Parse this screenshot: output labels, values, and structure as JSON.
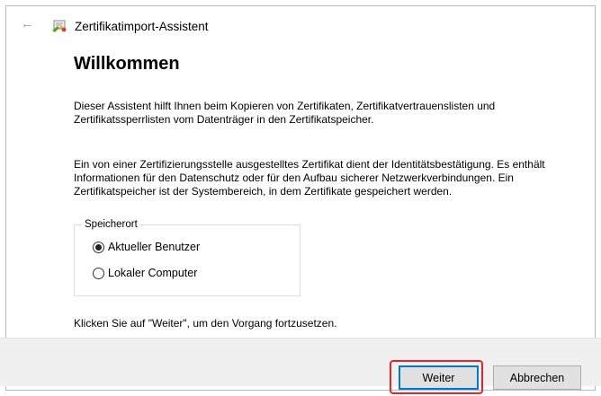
{
  "window": {
    "title": "Zertifikatimport-Assistent",
    "back_icon": "back-arrow-icon",
    "app_icon": "certificate-icon"
  },
  "main": {
    "heading": "Willkommen",
    "intro": "Dieser Assistent hilft Ihnen beim Kopieren von Zertifikaten, Zertifikatvertrauenslisten und Zertifikatssperrlisten vom Datenträger in den Zertifikatspeicher.",
    "description": "Ein von einer Zertifizierungsstelle ausgestelltes Zertifikat dient der Identitätsbestätigung. Es enthält Informationen für den Datenschutz oder für den Aufbau sicherer Netzwerkverbindungen. Ein Zertifikatspeicher ist der Systembereich, in dem Zertifikate gespeichert werden.",
    "storage": {
      "legend": "Speicherort",
      "options": [
        {
          "label": "Aktueller Benutzer",
          "checked": true
        },
        {
          "label": "Lokaler Computer",
          "checked": false
        }
      ]
    },
    "continue_hint": "Klicken Sie auf \"Weiter\", um den Vorgang fortzusetzen."
  },
  "footer": {
    "next_label": "Weiter",
    "cancel_label": "Abbrechen",
    "highlight_color": "#e8242a",
    "focus_color": "#0078d7"
  }
}
